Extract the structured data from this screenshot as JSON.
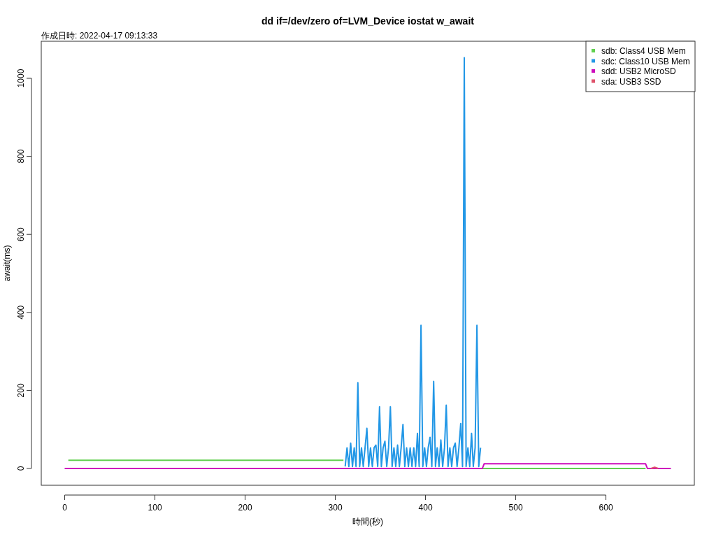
{
  "plot": {
    "title": "dd if=/dev/zero of=LVM_Device iostat w_await",
    "timestamp": "作成日時: 2022-04-17 09:13:33",
    "chart_data": {
      "type": "line",
      "xlabel": "時間(秒)",
      "ylabel": "await(ms)",
      "xlim": [
        -26,
        698
      ],
      "ylim": [
        -43,
        1095
      ],
      "xticks": [
        0,
        100,
        200,
        300,
        400,
        500,
        600
      ],
      "yticks": [
        0,
        200,
        400,
        600,
        800,
        1000
      ],
      "legend": true,
      "x": [
        0,
        3,
        4,
        100,
        200,
        309,
        311,
        313,
        315,
        317,
        319,
        321,
        323,
        325,
        327,
        329,
        331,
        333,
        335,
        337,
        339,
        341,
        343,
        345,
        347,
        349,
        351,
        353,
        355,
        357,
        359,
        361,
        363,
        365,
        367,
        369,
        371,
        373,
        375,
        377,
        379,
        381,
        383,
        385,
        387,
        389,
        391,
        393,
        395,
        397,
        399,
        401,
        403,
        405,
        407,
        409,
        411,
        413,
        415,
        417,
        419,
        421,
        423,
        425,
        427,
        429,
        431,
        433,
        435,
        437,
        439,
        441,
        443,
        445,
        447,
        449,
        451,
        453,
        455,
        457,
        459,
        461,
        463,
        465,
        550,
        644,
        646,
        650,
        654,
        658,
        672
      ],
      "series": [
        {
          "name": "sdb: Class4 USB Mem",
          "color": "#61d04f",
          "values": [
            null,
            null,
            21,
            21,
            21,
            21,
            null,
            null,
            null,
            null,
            null,
            null,
            null,
            null,
            null,
            null,
            null,
            null,
            null,
            null,
            null,
            null,
            null,
            null,
            null,
            null,
            null,
            null,
            null,
            null,
            null,
            null,
            null,
            null,
            null,
            null,
            null,
            null,
            null,
            null,
            null,
            null,
            null,
            null,
            null,
            null,
            null,
            null,
            null,
            null,
            null,
            null,
            null,
            null,
            null,
            null,
            null,
            null,
            null,
            null,
            null,
            null,
            null,
            null,
            null,
            null,
            null,
            null,
            null,
            null,
            null,
            null,
            null,
            null,
            null,
            null,
            null,
            null,
            null,
            null,
            null,
            null,
            0,
            0,
            0,
            0,
            null,
            null,
            null,
            null,
            null
          ]
        },
        {
          "name": "sdc: Class10 USB Mem",
          "color": "#2297e6",
          "values": [
            null,
            null,
            null,
            null,
            null,
            null,
            5,
            53,
            5,
            65,
            5,
            53,
            5,
            220,
            5,
            53,
            5,
            53,
            103,
            5,
            53,
            5,
            53,
            60,
            5,
            158,
            5,
            53,
            70,
            5,
            53,
            158,
            5,
            53,
            5,
            60,
            5,
            53,
            113,
            5,
            53,
            5,
            53,
            5,
            53,
            5,
            90,
            5,
            367,
            5,
            53,
            5,
            53,
            80,
            5,
            223,
            5,
            53,
            5,
            73,
            5,
            53,
            162,
            5,
            53,
            5,
            53,
            65,
            5,
            53,
            115,
            5,
            1053,
            5,
            53,
            5,
            90,
            5,
            53,
            367,
            5,
            53,
            null,
            null,
            null,
            null,
            null,
            null,
            null,
            null,
            null
          ]
        },
        {
          "name": "sdd: USB2 MicroSD",
          "color": "#cd0bbc",
          "values": [
            0,
            0,
            0,
            0,
            0,
            0,
            0,
            0,
            0,
            0,
            0,
            0,
            0,
            0,
            0,
            0,
            0,
            0,
            0,
            0,
            0,
            0,
            0,
            0,
            0,
            0,
            0,
            0,
            0,
            0,
            0,
            0,
            0,
            0,
            0,
            0,
            0,
            0,
            0,
            0,
            0,
            0,
            0,
            0,
            0,
            0,
            0,
            0,
            0,
            0,
            0,
            0,
            0,
            0,
            0,
            0,
            0,
            0,
            0,
            0,
            0,
            0,
            0,
            0,
            0,
            0,
            0,
            0,
            0,
            0,
            0,
            0,
            0,
            0,
            0,
            0,
            0,
            0,
            0,
            0,
            0,
            0,
            0,
            12,
            12,
            12,
            0,
            0,
            0,
            0,
            0
          ]
        },
        {
          "name": "sda: USB3 SSD",
          "color": "#df536b",
          "values": [
            null,
            null,
            null,
            null,
            null,
            null,
            null,
            null,
            null,
            null,
            null,
            null,
            null,
            null,
            null,
            null,
            null,
            null,
            null,
            null,
            null,
            null,
            null,
            null,
            null,
            null,
            null,
            null,
            null,
            null,
            null,
            null,
            null,
            null,
            null,
            null,
            null,
            null,
            null,
            null,
            null,
            null,
            null,
            null,
            null,
            null,
            null,
            null,
            null,
            null,
            null,
            null,
            null,
            null,
            null,
            null,
            null,
            null,
            null,
            null,
            null,
            null,
            null,
            null,
            null,
            null,
            null,
            null,
            null,
            null,
            null,
            null,
            null,
            null,
            null,
            null,
            null,
            null,
            null,
            null,
            null,
            null,
            null,
            null,
            null,
            null,
            null,
            0,
            3,
            0,
            null
          ]
        }
      ]
    }
  }
}
